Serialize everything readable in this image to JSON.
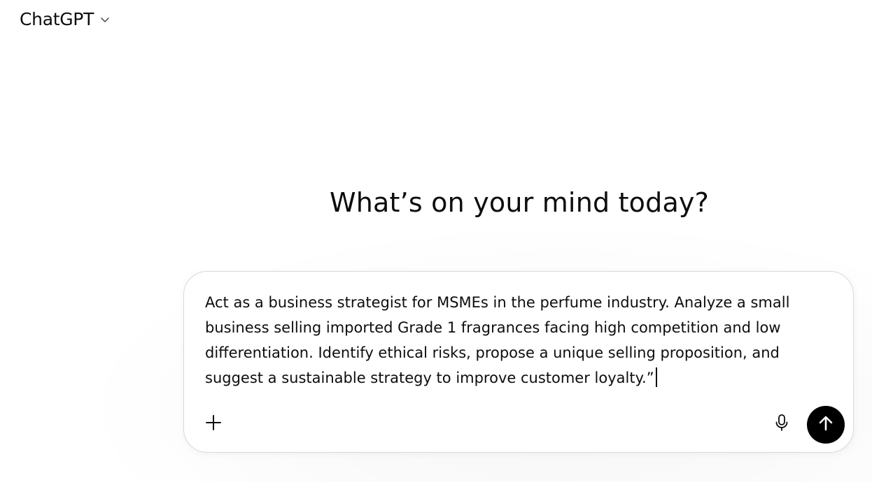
{
  "header": {
    "model_name": "ChatGPT",
    "model_menu_icon": "chevron-down-icon"
  },
  "main": {
    "headline": "What’s on your mind today?"
  },
  "composer": {
    "input_value": "Act as a business strategist for MSMEs in the perfume industry. Analyze a small business selling imported Grade 1 fragrances facing high competition and low differentiation. Identify ethical risks, propose a unique selling proposition, and suggest a sustainable strategy to improve customer loyalty.”",
    "attach_icon": "plus-icon",
    "voice_icon": "microphone-icon",
    "send_icon": "arrow-up-icon"
  },
  "colors": {
    "text": "#0d0d0d",
    "send_button": "#000000",
    "composer_border": "#d9d9d9",
    "background": "#ffffff"
  }
}
